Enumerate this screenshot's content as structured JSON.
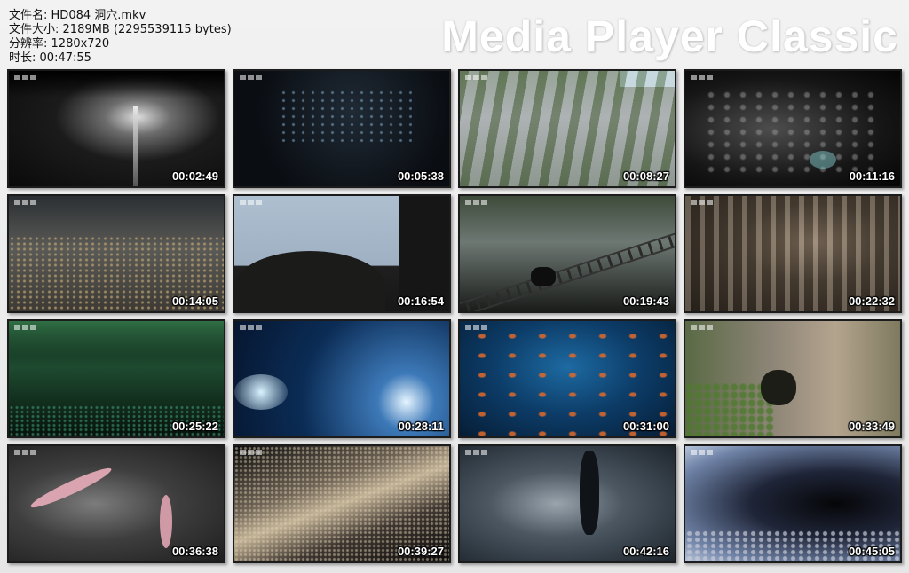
{
  "file_info": {
    "filename_label": "文件名:",
    "filename_value": "HD084 洞穴.mkv",
    "size_label": "文件大小:",
    "size_value": "2189MB (2295539115 bytes)",
    "resolution_label": "分辨率:",
    "resolution_value": "1280x720",
    "duration_label": "时长:",
    "duration_value": "00:47:55"
  },
  "brand": {
    "title": "Media Player Classic"
  },
  "thumbnails": [
    {
      "time": "00:02:49"
    },
    {
      "time": "00:05:38"
    },
    {
      "time": "00:08:27"
    },
    {
      "time": "00:11:16"
    },
    {
      "time": "00:14:05"
    },
    {
      "time": "00:16:54"
    },
    {
      "time": "00:19:43"
    },
    {
      "time": "00:22:32"
    },
    {
      "time": "00:25:22"
    },
    {
      "time": "00:28:11"
    },
    {
      "time": "00:31:00"
    },
    {
      "time": "00:33:49"
    },
    {
      "time": "00:36:38"
    },
    {
      "time": "00:39:27"
    },
    {
      "time": "00:42:16"
    },
    {
      "time": "00:45:05"
    }
  ]
}
